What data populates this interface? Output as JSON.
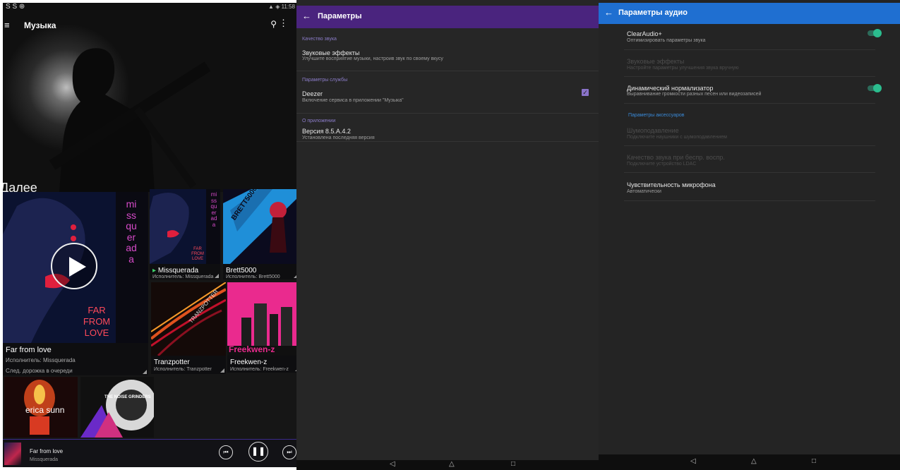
{
  "music": {
    "status_left": "S S ⊕",
    "status_right": "▲ ◈ 11:58",
    "app_title": "Музыка",
    "section_title": "Далее",
    "featured": {
      "title": "Far from love",
      "artist": "Исполнитель: Missquerada",
      "note": "След. дорожка в очереди",
      "art_text": [
        "FAR",
        "FROM",
        "LOVE"
      ],
      "art_side": "missquerada"
    },
    "tiles": [
      {
        "title": "Missquerada",
        "artist": "Исполнитель: Missquerada",
        "art_text": [
          "FAR",
          "FROM",
          "LOVE"
        ],
        "art_side": "missquerada",
        "playing": "▸"
      },
      {
        "title": "Brett5000",
        "artist": "Исполнитель: Brett5000",
        "art_text": "BRETT5000"
      },
      {
        "title": "Tranzpotter",
        "artist": "Исполнитель: Tranzpotter",
        "art_text": "TRANZPOTTER"
      },
      {
        "title": "Freekwen-z",
        "artist": "Исполнитель: Freekwen-z",
        "art_text": "Freekwen-z"
      }
    ],
    "bottom_tiles": [
      {
        "art_text": "erica sunn"
      },
      {
        "art_text": "THE NOISE GRINDERS"
      }
    ],
    "now_playing": {
      "title": "Far from love",
      "artist": "Missquerada"
    },
    "icons": {
      "menu": "menu-icon",
      "search": "search-icon",
      "more": "more-icon",
      "prev": "previous-icon",
      "pause": "pause-icon",
      "next": "next-icon"
    }
  },
  "settings": {
    "title": "Параметры",
    "categories": [
      "Качество звука",
      "Параметры службы",
      "О приложении"
    ],
    "items": [
      {
        "title": "Звуковые эффекты",
        "summary": "Улучшите восприятие музыки, настроив звук по своему вкусу"
      },
      {
        "title": "Deezer",
        "summary": "Включение сервиса в приложении \"Музыка\"",
        "checked": true
      },
      {
        "title": "Версия 8.5.A.4.2",
        "summary": "Установлена последняя версия"
      }
    ]
  },
  "audio": {
    "title": "Параметры аудио",
    "items": [
      {
        "title": "ClearAudio+",
        "summary": "Оптимизировать параметры звука",
        "toggle": true,
        "enabled": true
      },
      {
        "title": "Звуковые эффекты",
        "summary": "Настройте параметры улучшения звука вручную",
        "enabled": false
      },
      {
        "title": "Динамический нормализатор",
        "summary": "Выравнивание громкости разных песен или видеозаписей",
        "toggle": true,
        "enabled": true
      }
    ],
    "category": "Параметры аксессуаров",
    "accessory_items": [
      {
        "title": "Шумоподавление",
        "summary": "Подключите наушники с шумоподавлением",
        "enabled": false
      },
      {
        "title": "Качество звука при беспр. воспр.",
        "summary": "Подключите устройство LDAC",
        "enabled": false
      },
      {
        "title": "Чувствительность микрофона",
        "summary": "Автоматически",
        "enabled": true
      }
    ]
  },
  "nav": {
    "back": "◁",
    "home": "△",
    "recents": "□"
  },
  "colors": {
    "settings_bar": "#4a247e",
    "audio_bar": "#1f6fd1",
    "toggle_on": "#2bbd8e",
    "checkbox": "#8a73c9",
    "category_purple": "#8b7cc8",
    "category_blue": "#3a8ad8"
  }
}
